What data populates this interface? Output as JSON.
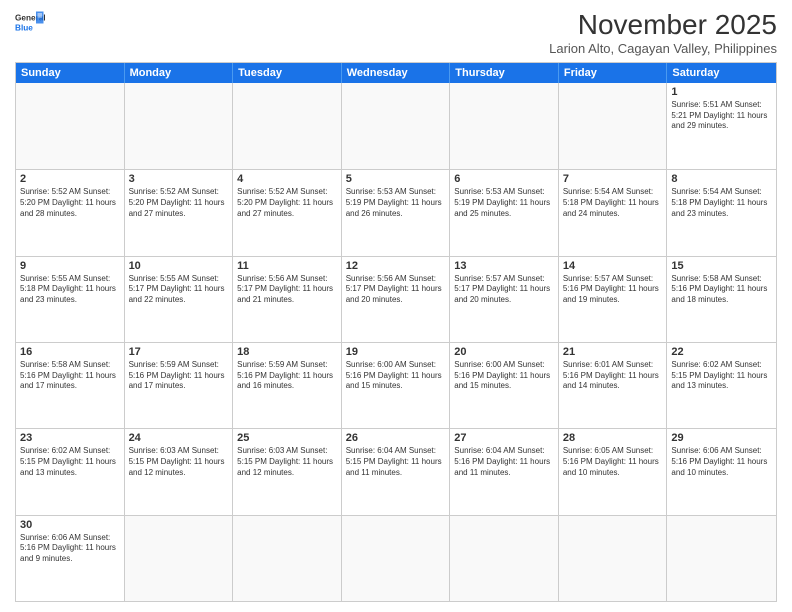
{
  "header": {
    "logo_general": "General",
    "logo_blue": "Blue",
    "title": "November 2025",
    "subtitle": "Larion Alto, Cagayan Valley, Philippines"
  },
  "days_of_week": [
    "Sunday",
    "Monday",
    "Tuesday",
    "Wednesday",
    "Thursday",
    "Friday",
    "Saturday"
  ],
  "weeks": [
    [
      {
        "day": "",
        "info": ""
      },
      {
        "day": "",
        "info": ""
      },
      {
        "day": "",
        "info": ""
      },
      {
        "day": "",
        "info": ""
      },
      {
        "day": "",
        "info": ""
      },
      {
        "day": "",
        "info": ""
      },
      {
        "day": "1",
        "info": "Sunrise: 5:51 AM\nSunset: 5:21 PM\nDaylight: 11 hours and 29 minutes."
      }
    ],
    [
      {
        "day": "2",
        "info": "Sunrise: 5:52 AM\nSunset: 5:20 PM\nDaylight: 11 hours and 28 minutes."
      },
      {
        "day": "3",
        "info": "Sunrise: 5:52 AM\nSunset: 5:20 PM\nDaylight: 11 hours and 27 minutes."
      },
      {
        "day": "4",
        "info": "Sunrise: 5:52 AM\nSunset: 5:20 PM\nDaylight: 11 hours and 27 minutes."
      },
      {
        "day": "5",
        "info": "Sunrise: 5:53 AM\nSunset: 5:19 PM\nDaylight: 11 hours and 26 minutes."
      },
      {
        "day": "6",
        "info": "Sunrise: 5:53 AM\nSunset: 5:19 PM\nDaylight: 11 hours and 25 minutes."
      },
      {
        "day": "7",
        "info": "Sunrise: 5:54 AM\nSunset: 5:18 PM\nDaylight: 11 hours and 24 minutes."
      },
      {
        "day": "8",
        "info": "Sunrise: 5:54 AM\nSunset: 5:18 PM\nDaylight: 11 hours and 23 minutes."
      }
    ],
    [
      {
        "day": "9",
        "info": "Sunrise: 5:55 AM\nSunset: 5:18 PM\nDaylight: 11 hours and 23 minutes."
      },
      {
        "day": "10",
        "info": "Sunrise: 5:55 AM\nSunset: 5:17 PM\nDaylight: 11 hours and 22 minutes."
      },
      {
        "day": "11",
        "info": "Sunrise: 5:56 AM\nSunset: 5:17 PM\nDaylight: 11 hours and 21 minutes."
      },
      {
        "day": "12",
        "info": "Sunrise: 5:56 AM\nSunset: 5:17 PM\nDaylight: 11 hours and 20 minutes."
      },
      {
        "day": "13",
        "info": "Sunrise: 5:57 AM\nSunset: 5:17 PM\nDaylight: 11 hours and 20 minutes."
      },
      {
        "day": "14",
        "info": "Sunrise: 5:57 AM\nSunset: 5:16 PM\nDaylight: 11 hours and 19 minutes."
      },
      {
        "day": "15",
        "info": "Sunrise: 5:58 AM\nSunset: 5:16 PM\nDaylight: 11 hours and 18 minutes."
      }
    ],
    [
      {
        "day": "16",
        "info": "Sunrise: 5:58 AM\nSunset: 5:16 PM\nDaylight: 11 hours and 17 minutes."
      },
      {
        "day": "17",
        "info": "Sunrise: 5:59 AM\nSunset: 5:16 PM\nDaylight: 11 hours and 17 minutes."
      },
      {
        "day": "18",
        "info": "Sunrise: 5:59 AM\nSunset: 5:16 PM\nDaylight: 11 hours and 16 minutes."
      },
      {
        "day": "19",
        "info": "Sunrise: 6:00 AM\nSunset: 5:16 PM\nDaylight: 11 hours and 15 minutes."
      },
      {
        "day": "20",
        "info": "Sunrise: 6:00 AM\nSunset: 5:16 PM\nDaylight: 11 hours and 15 minutes."
      },
      {
        "day": "21",
        "info": "Sunrise: 6:01 AM\nSunset: 5:16 PM\nDaylight: 11 hours and 14 minutes."
      },
      {
        "day": "22",
        "info": "Sunrise: 6:02 AM\nSunset: 5:15 PM\nDaylight: 11 hours and 13 minutes."
      }
    ],
    [
      {
        "day": "23",
        "info": "Sunrise: 6:02 AM\nSunset: 5:15 PM\nDaylight: 11 hours and 13 minutes."
      },
      {
        "day": "24",
        "info": "Sunrise: 6:03 AM\nSunset: 5:15 PM\nDaylight: 11 hours and 12 minutes."
      },
      {
        "day": "25",
        "info": "Sunrise: 6:03 AM\nSunset: 5:15 PM\nDaylight: 11 hours and 12 minutes."
      },
      {
        "day": "26",
        "info": "Sunrise: 6:04 AM\nSunset: 5:15 PM\nDaylight: 11 hours and 11 minutes."
      },
      {
        "day": "27",
        "info": "Sunrise: 6:04 AM\nSunset: 5:16 PM\nDaylight: 11 hours and 11 minutes."
      },
      {
        "day": "28",
        "info": "Sunrise: 6:05 AM\nSunset: 5:16 PM\nDaylight: 11 hours and 10 minutes."
      },
      {
        "day": "29",
        "info": "Sunrise: 6:06 AM\nSunset: 5:16 PM\nDaylight: 11 hours and 10 minutes."
      }
    ],
    [
      {
        "day": "30",
        "info": "Sunrise: 6:06 AM\nSunset: 5:16 PM\nDaylight: 11 hours and 9 minutes."
      },
      {
        "day": "",
        "info": ""
      },
      {
        "day": "",
        "info": ""
      },
      {
        "day": "",
        "info": ""
      },
      {
        "day": "",
        "info": ""
      },
      {
        "day": "",
        "info": ""
      },
      {
        "day": "",
        "info": ""
      }
    ]
  ]
}
